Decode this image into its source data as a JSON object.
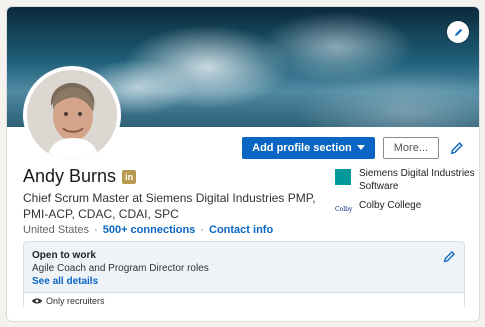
{
  "profile": {
    "name": "Andy Burns",
    "badge": "in",
    "headline": "Chief Scrum Master at Siemens Digital Industries PMP, PMI-ACP, CDAC, CDAI, SPC",
    "location": "United States",
    "separator": "·",
    "connections": "500+ connections",
    "contact_info": "Contact info"
  },
  "actions": {
    "add_section_label": "Add profile section",
    "more_label": "More..."
  },
  "organizations": [
    {
      "name": "Siemens Digital Industries Software",
      "logo": "siemens-logo"
    },
    {
      "name": "Colby College",
      "logo": "colby-logo",
      "logo_text": "Colby"
    }
  ],
  "open_to_work": {
    "title": "Open to work",
    "description": "Agile Coach and Program Director roles",
    "link": "See all details",
    "visibility": "Only recruiters"
  },
  "colors": {
    "primary": "#0a66c2",
    "premium_badge": "#b89950",
    "siemens": "#009999"
  }
}
